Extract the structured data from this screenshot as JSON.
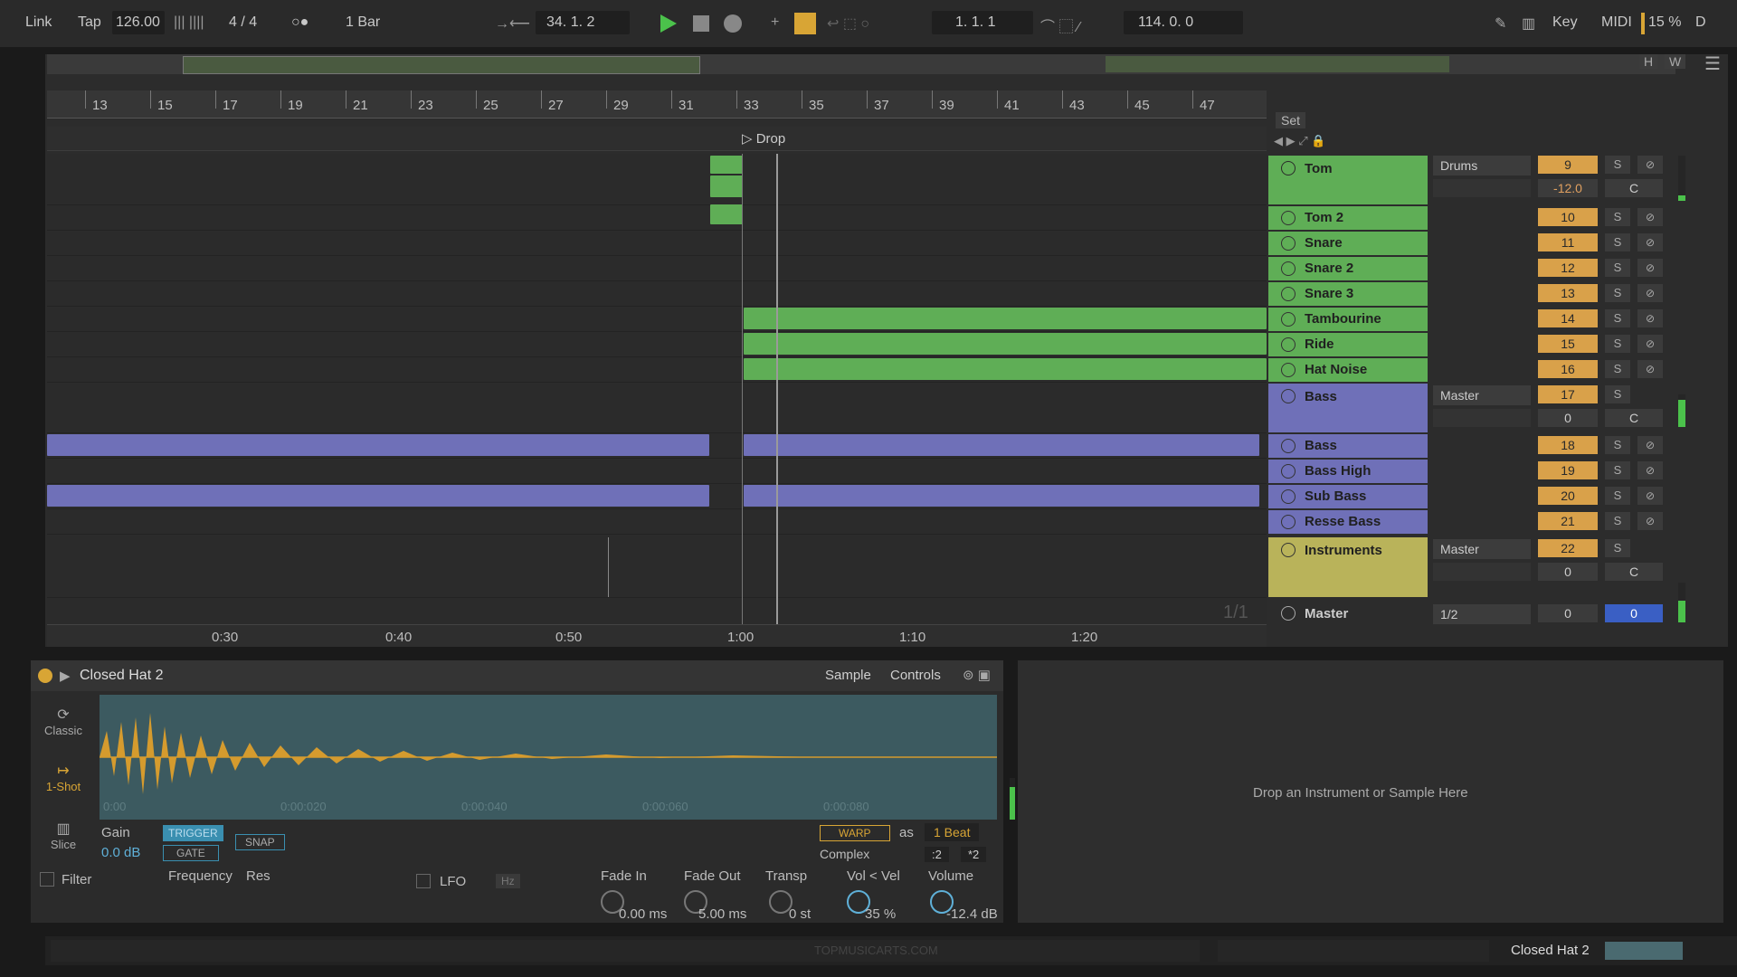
{
  "transport": {
    "link": "Link",
    "tap": "Tap",
    "tempo": "126.00",
    "time_sig": "4 / 4",
    "quantize": "1 Bar",
    "position": "34.  1.  2",
    "loop_start": "1.  1.  1",
    "loop_length": "114.  0.  0",
    "key_label": "Key",
    "midi_label": "MIDI",
    "cpu": "15 %",
    "d_label": "D"
  },
  "ruler": {
    "bars": [
      "13",
      "15",
      "17",
      "19",
      "21",
      "23",
      "25",
      "27",
      "29",
      "31",
      "33",
      "35",
      "37",
      "39",
      "41",
      "43",
      "45",
      "47"
    ],
    "times": [
      "0:30",
      "0:40",
      "0:50",
      "1:00",
      "1:10",
      "1:20"
    ]
  },
  "locator": "Drop",
  "set_label": "Set",
  "overview_btns": {
    "h": "H",
    "w": "W"
  },
  "tracks": [
    {
      "name": "Tom",
      "color": "#5fae56",
      "num": "9",
      "routing": "Drums",
      "vol": "-12.0",
      "pan": "C",
      "s": "S"
    },
    {
      "name": "Tom 2",
      "color": "#5fae56",
      "num": "10",
      "s": "S"
    },
    {
      "name": "Snare",
      "color": "#5fae56",
      "num": "11",
      "s": "S"
    },
    {
      "name": "Snare 2",
      "color": "#5fae56",
      "num": "12",
      "s": "S"
    },
    {
      "name": "Snare 3",
      "color": "#5fae56",
      "num": "13",
      "s": "S"
    },
    {
      "name": "Tambourine",
      "color": "#5fae56",
      "num": "14",
      "s": "S"
    },
    {
      "name": "Ride",
      "color": "#5fae56",
      "num": "15",
      "s": "S"
    },
    {
      "name": "Hat Noise",
      "color": "#5fae56",
      "num": "16",
      "s": "S"
    },
    {
      "name": "Bass",
      "color": "#6f70b8",
      "num": "17",
      "routing": "Master",
      "vol": "0",
      "pan": "C",
      "s": "S"
    },
    {
      "name": "Bass",
      "color": "#6f70b8",
      "num": "18",
      "s": "S"
    },
    {
      "name": "Bass High",
      "color": "#6f70b8",
      "num": "19",
      "s": "S"
    },
    {
      "name": "Sub Bass",
      "color": "#6f70b8",
      "num": "20",
      "s": "S"
    },
    {
      "name": "Resse Bass",
      "color": "#6f70b8",
      "num": "21",
      "s": "S"
    },
    {
      "name": "Instruments",
      "color": "#b9b35a",
      "num": "22",
      "routing": "Master",
      "vol": "0",
      "pan": "C",
      "s": "S"
    },
    {
      "name": "Master",
      "color": "#2c2c2c",
      "num": "0",
      "routing": "1/2",
      "vol": "0"
    }
  ],
  "page_indicator": "1/1",
  "device": {
    "title": "Closed Hat 2",
    "tab_sample": "Sample",
    "tab_controls": "Controls",
    "modes": [
      "Classic",
      "1-Shot",
      "Slice"
    ],
    "gain_label": "Gain",
    "gain_value": "0.0 dB",
    "trigger": "TRIGGER",
    "gate": "GATE",
    "snap": "SNAP",
    "warp": "WARP",
    "as": "as",
    "beat": "1 Beat",
    "complex": "Complex",
    "div2": ":2",
    "mul2": "*2",
    "wave_times": [
      "0:00",
      "0:00:020",
      "0:00:040",
      "0:00:060",
      "0:00:080"
    ],
    "filter": "Filter",
    "frequency": "Frequency",
    "res": "Res",
    "lfo": "LFO",
    "hz": "Hz",
    "fade_in_label": "Fade In",
    "fade_in": "0.00 ms",
    "fade_out_label": "Fade Out",
    "fade_out": "5.00 ms",
    "transp_label": "Transp",
    "transp": "0 st",
    "velvol_label": "Vol < Vel",
    "velvol": "35 %",
    "volume_label": "Volume",
    "volume": "-12.4 dB"
  },
  "dropzone_text": "Drop an Instrument or Sample Here",
  "status": {
    "watermark": "TOPMUSICARTS.COM",
    "selected": "Closed Hat 2"
  }
}
